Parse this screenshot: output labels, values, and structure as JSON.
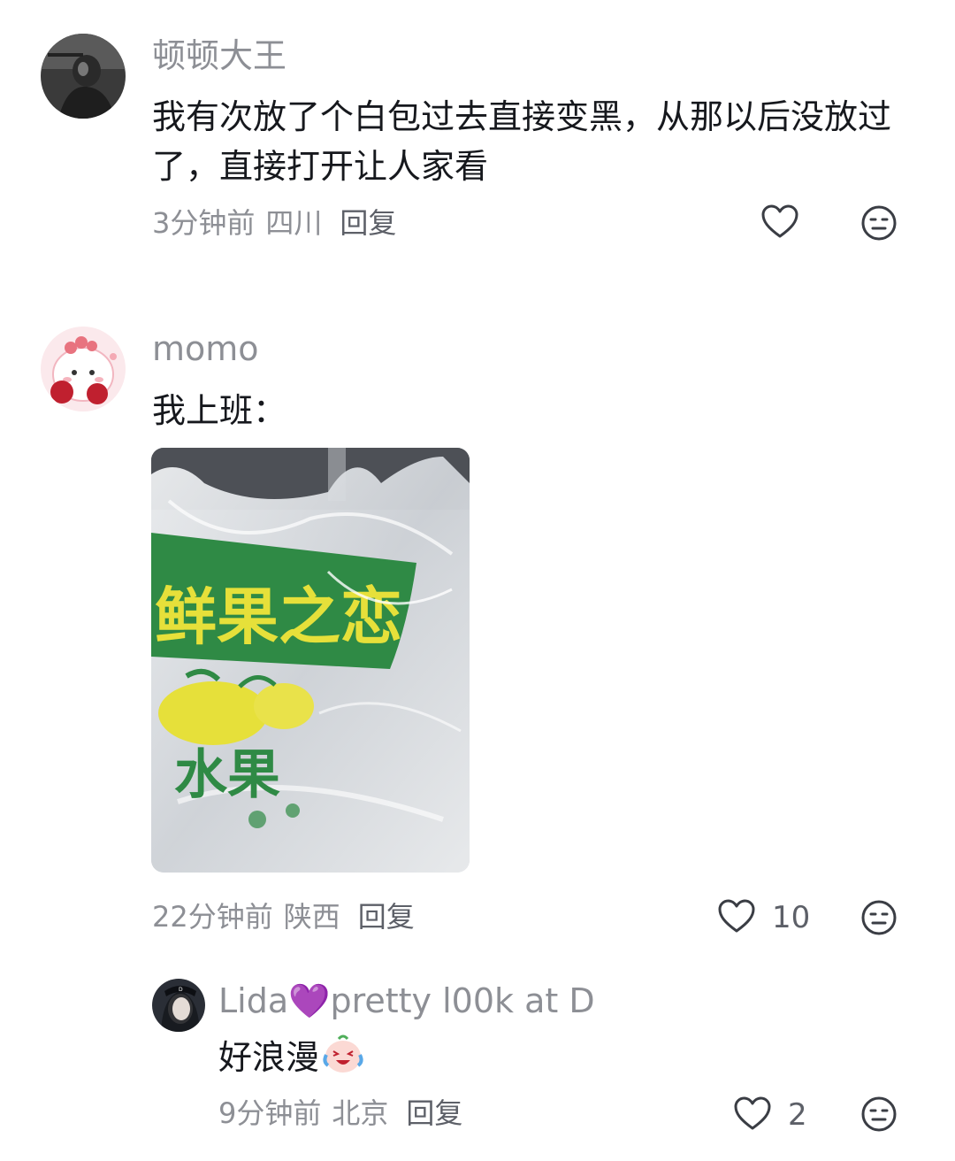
{
  "comments": [
    {
      "username": "顿顿大王",
      "text": "我有次放了个白包过去直接变黑，从那以后没放过了，直接打开让人家看",
      "time": "3分钟前",
      "location": "四川",
      "reply_label": "回复",
      "likes": ""
    },
    {
      "username": "momo",
      "text": "我上班：",
      "time": "22分钟前",
      "location": "陕西",
      "reply_label": "回复",
      "likes": "10",
      "image": {
        "bag_text_top": "鲜果之恋",
        "bag_text_bottom": "水果"
      },
      "replies": [
        {
          "username": "Lida💜pretty l00k at D",
          "text": "好浪漫",
          "emoji": "crying-laughing-emoji",
          "time": "9分钟前",
          "location": "北京",
          "reply_label": "回复",
          "likes": "2"
        }
      ]
    }
  ],
  "colors": {
    "meta_text": "#8d8f95",
    "body_text": "#16181d",
    "icon_stroke": "#3a3d44",
    "bag_green": "#2f8a45",
    "bag_yellow": "#e6e03a"
  }
}
